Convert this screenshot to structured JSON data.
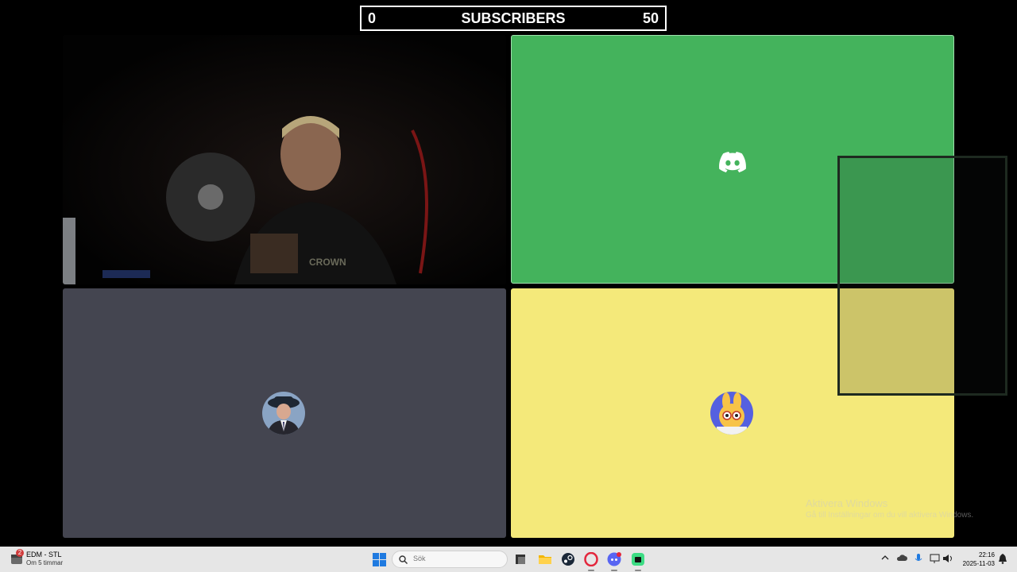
{
  "subscriber_goal": {
    "current": "0",
    "label": "SUBSCRIBERS",
    "goal": "50"
  },
  "call": {
    "tiles": [
      {
        "id": "webcam",
        "kind": "camera"
      },
      {
        "id": "discord-user",
        "kind": "discord-logo",
        "color": "#44b35c"
      },
      {
        "id": "user-man",
        "kind": "avatar",
        "color": "#444550"
      },
      {
        "id": "user-bunny",
        "kind": "avatar",
        "color": "#f4e97a"
      }
    ]
  },
  "watermark": {
    "title": "Aktivera Windows",
    "subtitle": "Gå till Inställningar om du vill aktivera Windows."
  },
  "taskbar": {
    "weather": {
      "title": "EDM - STL",
      "subtitle": "Om 5 timmar",
      "badge": "2"
    },
    "search": {
      "placeholder": "Sök"
    },
    "apps": [
      "task-view",
      "file-explorer",
      "steam",
      "opera",
      "discord",
      "app"
    ],
    "clock": {
      "time": "22:16",
      "date": "2025-11-03"
    }
  }
}
